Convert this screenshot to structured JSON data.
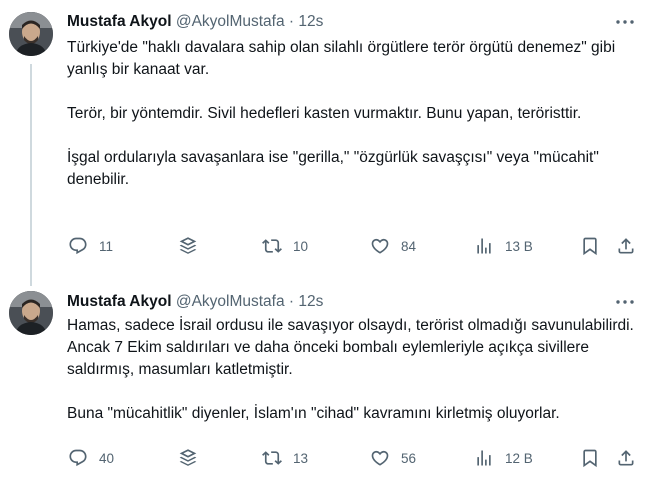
{
  "tweets": [
    {
      "author_name": "Mustafa Akyol",
      "handle": "@AkyolMustafa",
      "separator": "·",
      "time": "12s",
      "paragraphs": [
        "Türkiye'de \"haklı davalara sahip olan silahlı örgütlere terör örgütü denemez\" gibi yanlış bir kanaat var.",
        "Terör, bir yöntemdir. Sivil hedefleri kasten vurmaktır. Bunu yapan, teröristtir.",
        "İşgal ordularıyla savaşanlara ise \"gerilla,\" \"özgürlük savaşçısı\" veya \"mücahit\" denebilir."
      ],
      "replies": "11",
      "reposts": "10",
      "likes": "84",
      "views": "13 B"
    },
    {
      "author_name": "Mustafa Akyol",
      "handle": "@AkyolMustafa",
      "separator": "·",
      "time": "12s",
      "paragraphs": [
        "Hamas, sadece İsrail ordusu ile savaşıyor olsaydı, terörist olmadığı savunulabilirdi. Ancak 7 Ekim saldırıları ve daha önceki bombalı eylemleriyle açıkça sivillere saldırmış, masumları katletmiştir.",
        "Buna \"mücahitlik\" diyenler, İslam'ın \"cihad\" kavramını kirletmiş oluyorlar."
      ],
      "replies": "40",
      "reposts": "13",
      "likes": "56",
      "views": "12 B"
    }
  ],
  "icons": {
    "more": "more-horizontal-icon",
    "reply": "reply-icon",
    "grok": "grok-icon",
    "repost": "repost-icon",
    "like": "like-icon",
    "views": "views-icon",
    "bookmark": "bookmark-icon",
    "share": "share-icon"
  },
  "colors": {
    "text_primary": "#0f1419",
    "text_secondary": "#536471",
    "thread_line": "#cfd9de",
    "background": "#ffffff"
  }
}
